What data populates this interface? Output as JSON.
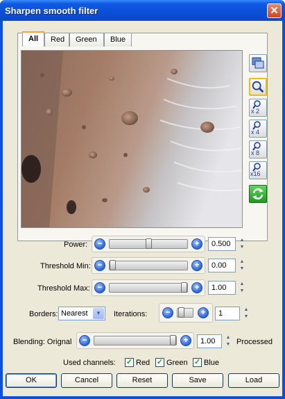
{
  "window": {
    "title": "Sharpen smooth filter",
    "close_glyph": "✕"
  },
  "tabs": [
    "All",
    "Red",
    "Green",
    "Blue"
  ],
  "toolbar": {
    "zoom_x2": "x 2",
    "zoom_x4": "x 4",
    "zoom_x8": "x 8",
    "zoom_x16": "x16"
  },
  "controls": {
    "power": {
      "label": "Power:",
      "value": "0.500",
      "level": 0.5
    },
    "threshold_min": {
      "label": "Threshold Min:",
      "value": "0.00",
      "level": 0.0
    },
    "threshold_max": {
      "label": "Threshold Max:",
      "value": "1.00",
      "level": 1.0
    },
    "borders": {
      "label": "Borders:",
      "selected": "Nearest"
    },
    "iterations": {
      "label": "Iterations:",
      "value": "1"
    },
    "blending": {
      "label": "Blending: Orignal",
      "value": "1.00",
      "level": 1.0,
      "end_label": "Processed"
    }
  },
  "channels": {
    "label": "Used channels:",
    "items": [
      {
        "label": "Red",
        "checked": true
      },
      {
        "label": "Green",
        "checked": true
      },
      {
        "label": "Blue",
        "checked": true
      }
    ]
  },
  "buttons": {
    "ok": "OK",
    "cancel": "Cancel",
    "reset": "Reset",
    "save": "Save",
    "load": "Load"
  },
  "icons": {
    "fit": "fit-to-window-icon",
    "zoom": "magnifier-icon",
    "refresh": "refresh-icon",
    "minus": "−",
    "plus": "+",
    "up": "▲",
    "down": "▼",
    "check": "✓"
  }
}
